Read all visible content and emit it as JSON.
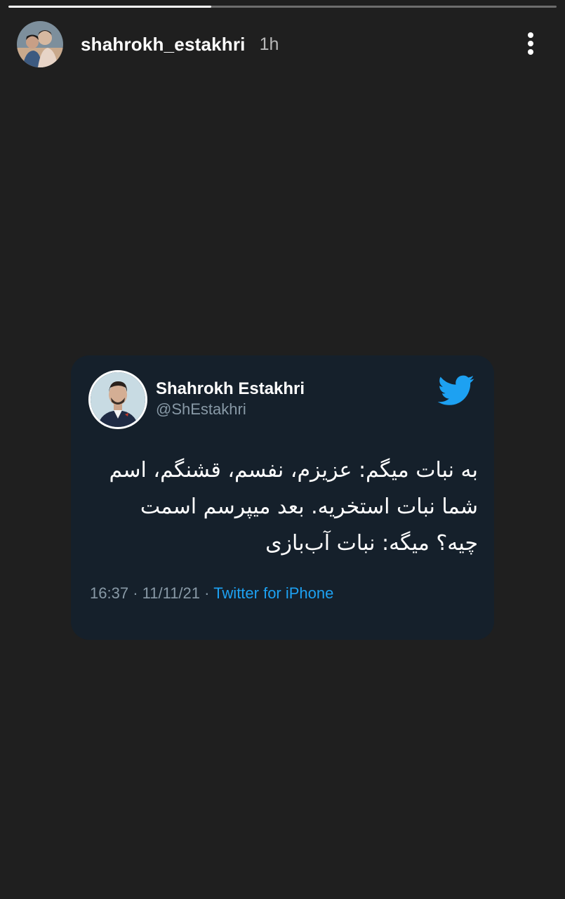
{
  "story": {
    "progress": 0.37,
    "username": "shahrokh_estakhri",
    "time": "1h",
    "more_icon": "vertical-dots-icon"
  },
  "tweet": {
    "display_name": "Shahrokh Estakhri",
    "handle": "@ShEstakhri",
    "logo_icon": "twitter-bird-icon",
    "text": "به نبات میگم: عزیزم، نفسم، قشنگم، اسم شما نبات استخریه. بعد میپرسم اسمت چیه؟ میگه: نبات آب‌بازی",
    "time": "16:37",
    "date": "11/11/21",
    "separator": "·",
    "source": "Twitter for iPhone"
  },
  "colors": {
    "background": "#1f1f1f",
    "card": "#15202b",
    "twitter_blue": "#1da1f2",
    "muted": "#8899a6"
  }
}
